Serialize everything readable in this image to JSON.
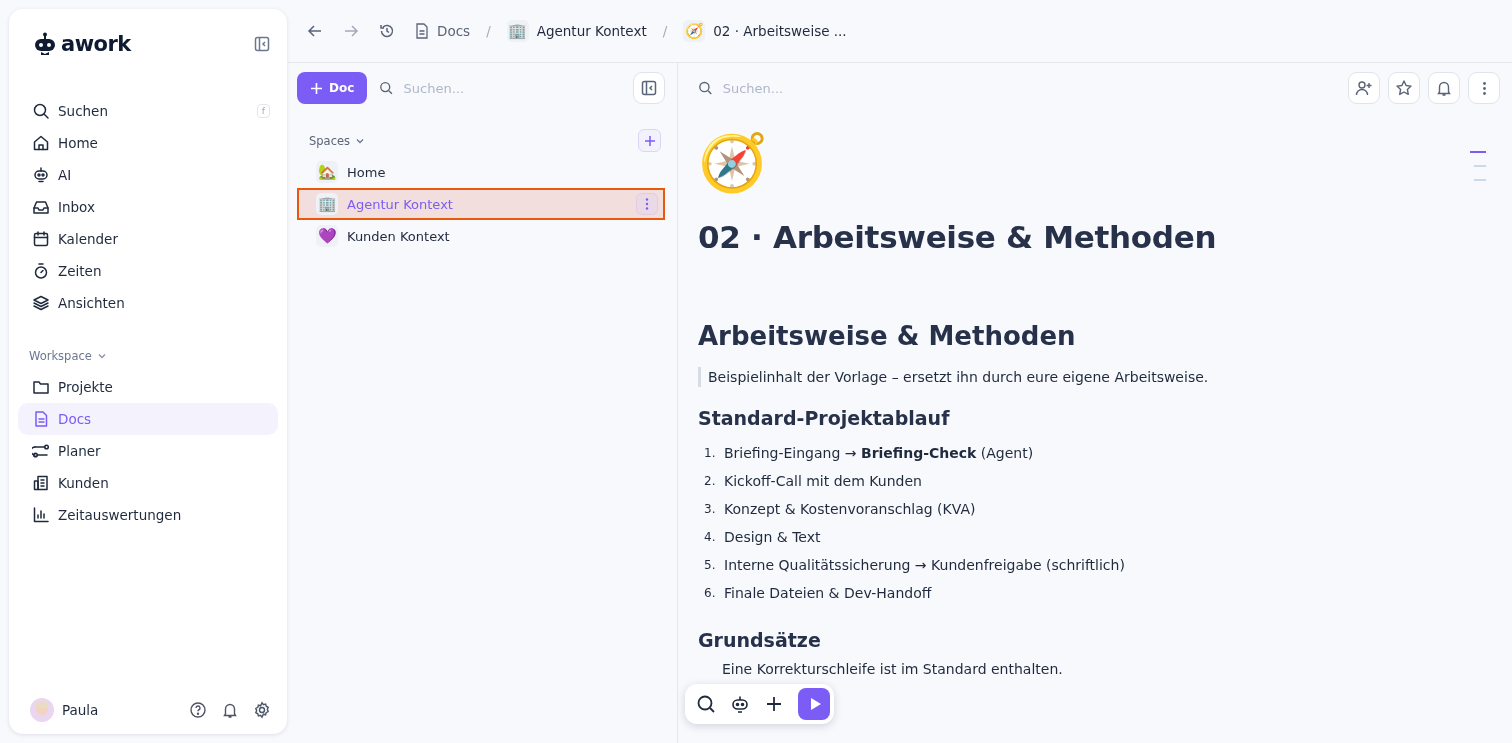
{
  "sidebar": {
    "logo": "awork",
    "nav": [
      {
        "label": "Suchen",
        "shortcut": "f",
        "selected": false
      },
      {
        "label": "Home",
        "selected": false
      },
      {
        "label": "AI",
        "selected": false
      },
      {
        "label": "Inbox",
        "selected": false
      },
      {
        "label": "Kalender",
        "selected": false
      },
      {
        "label": "Zeiten",
        "selected": false
      },
      {
        "label": "Ansichten",
        "selected": false
      }
    ],
    "section": "Workspace",
    "workspace": [
      {
        "label": "Projekte",
        "selected": false
      },
      {
        "label": "Docs",
        "selected": true
      },
      {
        "label": "Planer",
        "selected": false
      },
      {
        "label": "Kunden",
        "selected": false
      },
      {
        "label": "Zeitauswertungen",
        "selected": false
      }
    ],
    "user": "Paula"
  },
  "breadcrumb": [
    {
      "label": "Docs"
    },
    {
      "separator": "/",
      "icon": "🏢",
      "label": "Agentur Kontext"
    },
    {
      "separator": "/",
      "icon": "🧭",
      "label": "02 · Arbeitsweise ..."
    }
  ],
  "docs_panel": {
    "new_button": "Doc",
    "search": {
      "placeholder": "Suchen..."
    },
    "section": "Spaces",
    "spaces": [
      {
        "icon": "🏡",
        "label": "Home",
        "selected": false
      },
      {
        "icon": "🏢",
        "label": "Agentur Kontext",
        "selected": true
      },
      {
        "icon": "💜",
        "label": "Kunden Kontext",
        "selected": false
      }
    ]
  },
  "document": {
    "search": {
      "placeholder": "Suchen..."
    },
    "icon": "🧭",
    "title": "02 · Arbeitsweise & Methoden",
    "heading": "Arbeitsweise & Methoden",
    "quote": "Beispielinhalt der Vorlage – ersetzt ihn durch eure eigene Arbeitsweise.",
    "subheading": "Standard-Projektablauf",
    "steps": [
      {
        "number": "1.",
        "text": "Briefing-Eingang → **Briefing-Check** (Agent)"
      },
      {
        "number": "2.",
        "text": "Kickoff-Call mit dem Kunden"
      },
      {
        "number": "3.",
        "text": "Konzept & Kostenvoranschlag (KVA)"
      },
      {
        "number": "4.",
        "text": "Design & Text"
      },
      {
        "number": "5.",
        "text": "Interne Qualitätssicherung → Kundenfreigabe (schriftlich)"
      },
      {
        "number": "6.",
        "text": "Finale Dateien & Dev-Handoff"
      }
    ],
    "subheading_2": "Grundsätze",
    "principles": [
      "Eine Korrekturschleife ist im Standard enthalten."
    ]
  }
}
